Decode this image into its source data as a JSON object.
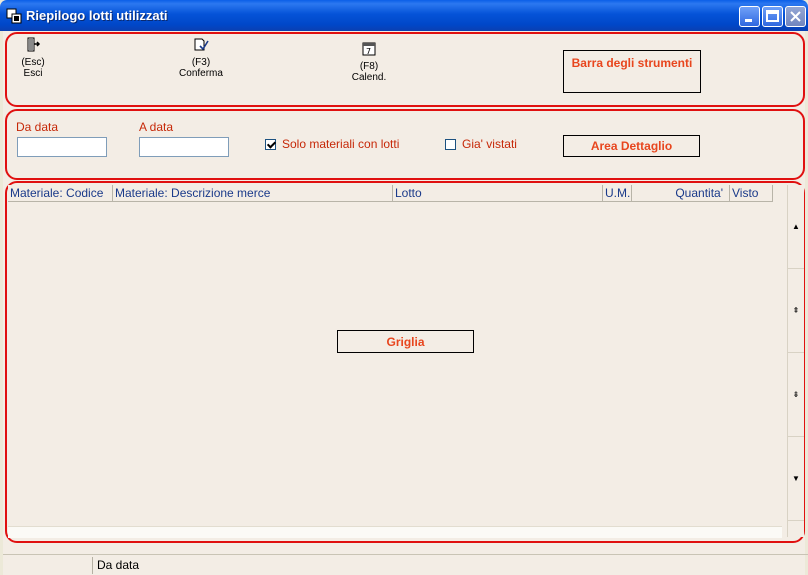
{
  "window": {
    "title": "Riepilogo lotti utilizzati"
  },
  "toolbar": {
    "esc": {
      "key": "(Esc)",
      "label": "Esci",
      "icon": "exit-door-icon"
    },
    "conferma": {
      "key": "(F3)",
      "label": "Conferma",
      "icon": "confirm-check-icon"
    },
    "calend": {
      "key": "(F8)",
      "label": "Calend.",
      "icon": "calendar-icon"
    },
    "annotation": "Barra degli strumenti"
  },
  "detail": {
    "da_data_label": "Da data",
    "da_data_value": "",
    "a_data_label": "A data",
    "a_data_value": "",
    "solo_materiali_label": "Solo materiali con lotti",
    "solo_materiali_checked": true,
    "gia_vistati_label": "Gia' vistati",
    "gia_vistati_checked": false,
    "annotation": "Area Dettaglio"
  },
  "grid": {
    "columns": [
      "Materiale: Codice",
      "Materiale: Descrizione merce",
      "Lotto",
      "U.M.",
      "Quantita'",
      "Visto"
    ],
    "rows": [],
    "annotation": "Griglia"
  },
  "statusbar": {
    "cell1": "",
    "cell2": "Da data"
  },
  "colors": {
    "annotation_border": "#e01010",
    "annotation_text": "#e8461e",
    "field_label": "#c62808",
    "grid_header_text": "#1a3a8a",
    "titlebar": "#0553d8"
  }
}
